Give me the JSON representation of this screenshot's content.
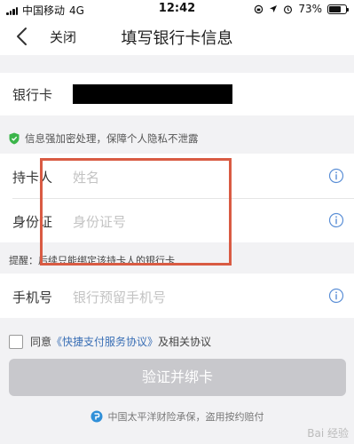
{
  "status_bar": {
    "carrier": "中国移动",
    "network": "4G",
    "time": "12:42",
    "battery": "73%",
    "battery_level": 0.73
  },
  "nav": {
    "close_label": "关闭",
    "title": "填写银行卡信息"
  },
  "bank_card": {
    "label": "银行卡"
  },
  "privacy_note": "信息强加密处理，保障个人隐私不泄露",
  "form": {
    "cardholder_label": "持卡人",
    "cardholder_placeholder": "姓名",
    "id_label": "身份证",
    "id_placeholder": "身份证号"
  },
  "reminder": "提醒：后续只能绑定该持卡人的银行卡",
  "phone": {
    "label": "手机号",
    "placeholder": "银行预留手机号"
  },
  "agreement": {
    "prefix": "同意",
    "link": "《快捷支付服务协议》",
    "suffix": "及相关协议"
  },
  "submit_label": "验证并绑卡",
  "footer_text": "中国太平洋财险承保，盗用按约赔付",
  "watermark": "Bai 经验",
  "colors": {
    "accent_link": "#3a6fb5",
    "highlight_border": "#d95b43",
    "disabled_button": "#c8c8cc",
    "info_icon": "#5b8fd6",
    "shield_green": "#3bb54a"
  },
  "icons": {
    "back": "chevron-left-icon",
    "location": "location-arrow-icon",
    "alarm": "alarm-clock-icon",
    "info": "info-circle-icon",
    "shield": "shield-check-icon",
    "insurance": "insurance-logo-icon"
  }
}
